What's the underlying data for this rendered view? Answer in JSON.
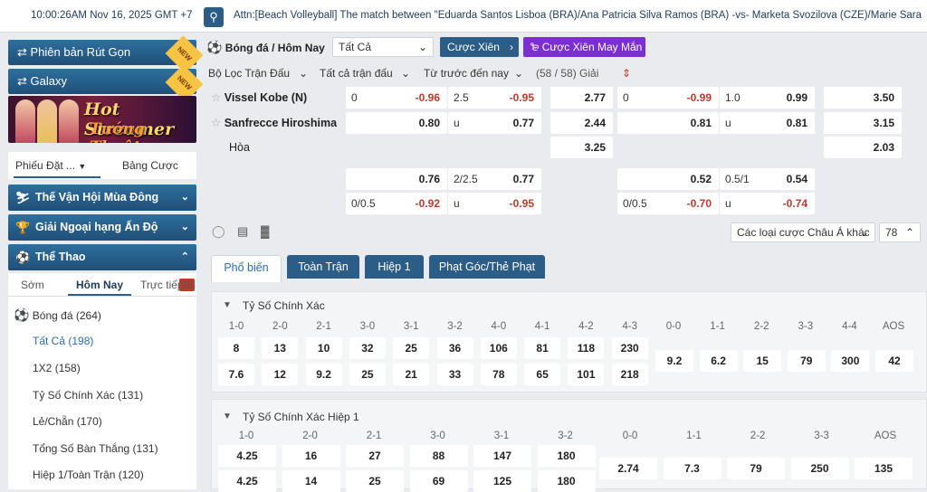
{
  "top": {
    "time": "10:00:26AM Nov 16, 2025 GMT +7",
    "ticker": "Attn:[Beach Volleyball] The match between \"Eduarda Santos Lisboa (BRA)/Ana Patricia Silva Ramos (BRA) -vs- Marketa Svozilova (CZE)/Marie Sara"
  },
  "sidebar": {
    "quick": "Phiên bản Rút Gọn",
    "galaxy": "Galaxy",
    "new": "NEW",
    "banner1": "Hot Streamer",
    "banner2": "Tướng Thuật",
    "tab1": "Phiếu Đặt ...",
    "tab2": "Bảng Cược",
    "cats": [
      "Thế Vận Hội Mùa Đông",
      "Giải Ngoại hạng Ấn Độ",
      "Thể Thao"
    ],
    "sport_tabs": [
      "Sớm",
      "Hôm Nay",
      "Trực tiếp"
    ],
    "live_count": "98",
    "soccer": "Bóng đá",
    "soccer_count": "(264)",
    "items": [
      {
        "label": "Tất Cả",
        "count": "(198)"
      },
      {
        "label": "1X2",
        "count": "(158)"
      },
      {
        "label": "Tỷ Số Chính Xác",
        "count": "(131)"
      },
      {
        "label": "Lẻ/Chẵn",
        "count": "(170)"
      },
      {
        "label": "Tổng Số Bàn Thắng",
        "count": "(131)"
      },
      {
        "label": "Hiệp 1/Toàn Trận",
        "count": "(120)"
      }
    ]
  },
  "main": {
    "title": "Bóng đá / Hôm Nay",
    "all": "Tất Cả",
    "parlay": "Cược Xiên",
    "lucky": "Cược Xiên May Mắn",
    "filter1": "Bộ Lọc Trận Đấu",
    "filter2": "Tất cả trận đấu",
    "filter3": "Từ trước đến nay",
    "league_count": "(58 / 58) Giải",
    "teams": [
      "Vissel Kobe (N)",
      "Sanfrecce Hiroshima",
      "Hòa"
    ],
    "row1": [
      [
        "0",
        "-0.96"
      ],
      [
        "2.5",
        "-0.95"
      ],
      [
        "",
        "2.77"
      ],
      [
        "0",
        "-0.99"
      ],
      [
        "1.0",
        "0.99"
      ],
      [
        "",
        "3.50"
      ]
    ],
    "row2": [
      [
        "",
        "0.80"
      ],
      [
        "u",
        "0.77"
      ],
      [
        "",
        "2.44"
      ],
      [
        "",
        "0.81"
      ],
      [
        "u",
        "0.81"
      ],
      [
        "",
        "3.15"
      ]
    ],
    "row3": [
      [
        "",
        "3.25"
      ],
      [
        "",
        "2.03"
      ]
    ],
    "row4": [
      [
        "",
        "0.76"
      ],
      [
        "2/2.5",
        "0.77"
      ],
      [
        "",
        "0.52"
      ],
      [
        "0.5/1",
        "0.54"
      ]
    ],
    "row5": [
      [
        "0/0.5",
        "-0.92"
      ],
      [
        "u",
        "-0.95"
      ],
      [
        "0/0.5",
        "-0.70"
      ],
      [
        "u",
        "-0.74"
      ]
    ],
    "other_bets": "Các loại cược Châu Á khác",
    "market_count": "78",
    "tabs": [
      "Phổ biến",
      "Toàn Trận",
      "Hiệp 1",
      "Phạt Góc/Thẻ Phạt"
    ],
    "cs_title": "Tỷ Số Chính Xác",
    "cs_heads": [
      "1-0",
      "2-0",
      "2-1",
      "3-0",
      "3-1",
      "3-2",
      "4-0",
      "4-1",
      "4-2",
      "4-3",
      "0-0",
      "1-1",
      "2-2",
      "3-3",
      "4-4",
      "AOS"
    ],
    "cs_home": [
      "8",
      "13",
      "10",
      "32",
      "25",
      "36",
      "106",
      "81",
      "118",
      "230"
    ],
    "cs_away": [
      "7.6",
      "12",
      "9.2",
      "25",
      "21",
      "33",
      "78",
      "65",
      "101",
      "218"
    ],
    "cs_draw": [
      "9.2",
      "6.2",
      "15",
      "79",
      "300",
      "42"
    ],
    "cs1_title": "Tỷ Số Chính Xác Hiệp 1",
    "cs1_heads": [
      "1-0",
      "2-0",
      "2-1",
      "3-0",
      "3-1",
      "3-2",
      "0-0",
      "1-1",
      "2-2",
      "3-3",
      "AOS"
    ],
    "cs1_home": [
      "4.25",
      "16",
      "27",
      "88",
      "147",
      "180"
    ],
    "cs1_away": [
      "4.25",
      "14",
      "25",
      "69",
      "125",
      "180"
    ],
    "cs1_draw": [
      "2.74",
      "7.3",
      "79",
      "250",
      "135"
    ]
  }
}
